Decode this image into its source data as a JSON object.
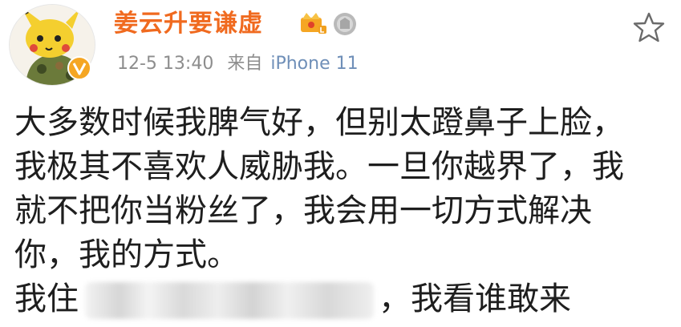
{
  "post": {
    "username": "姜云升要谦虚",
    "time": "12-5 13:40",
    "source_prefix": "来自",
    "device": "iPhone 11",
    "lines": [
      "大多数时候我脾气好，但别太蹬鼻子上脸，",
      "我极其不喜欢人威胁我。一旦你越界了，我",
      "就不把你当粉丝了，我会用一切方式解决",
      "你，我的方式。"
    ],
    "last_line_start": "我住",
    "last_line_end": "，我看谁敢来"
  },
  "icons": {
    "avatar": "pikachu-avatar",
    "verified": "verified-v-icon",
    "badge_1": "crown-vip-icon",
    "badge_2": "medal-icon",
    "star": "star-outline-icon"
  },
  "colors": {
    "username": "#f06a1f",
    "meta": "#8d8d8d",
    "device": "#6f8fb8",
    "text": "#1e1e1e"
  }
}
